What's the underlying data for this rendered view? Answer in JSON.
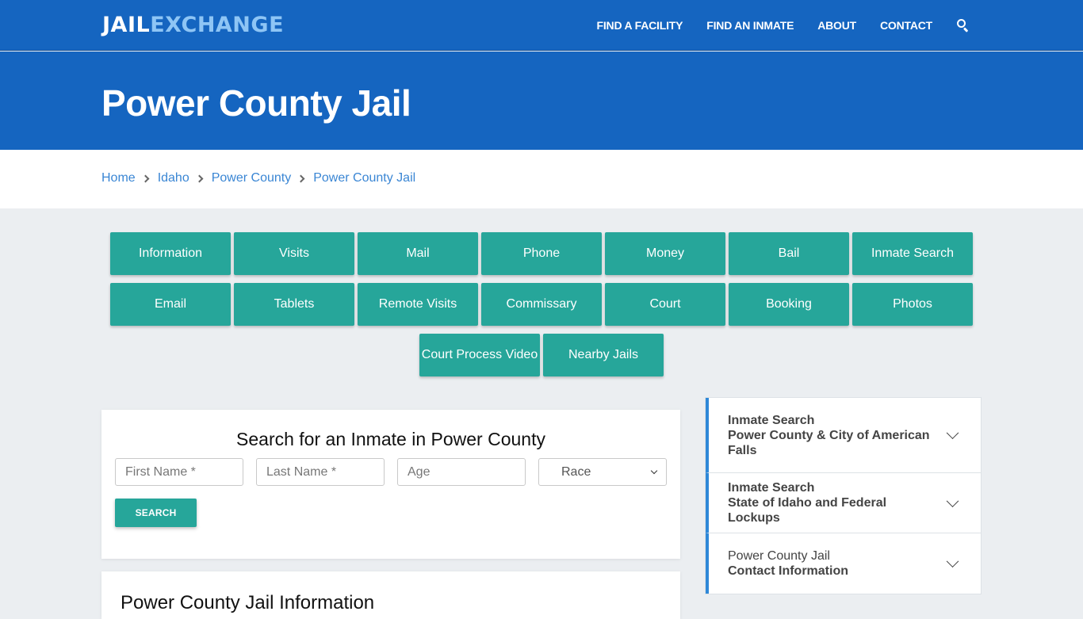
{
  "header": {
    "logo_part1": "JAIL",
    "logo_part2": "EXCHANGE",
    "nav": [
      {
        "label": "FIND A FACILITY"
      },
      {
        "label": "FIND AN INMATE"
      },
      {
        "label": "ABOUT"
      },
      {
        "label": "CONTACT"
      }
    ],
    "search_icon": "search-icon"
  },
  "hero": {
    "title": "Power County Jail"
  },
  "breadcrumb": [
    {
      "label": "Home"
    },
    {
      "label": "Idaho"
    },
    {
      "label": "Power County"
    },
    {
      "label": "Power County Jail"
    }
  ],
  "tiles": [
    {
      "label": "Information"
    },
    {
      "label": "Visits"
    },
    {
      "label": "Mail"
    },
    {
      "label": "Phone"
    },
    {
      "label": "Money"
    },
    {
      "label": "Bail"
    },
    {
      "label": "Inmate Search"
    },
    {
      "label": "Email"
    },
    {
      "label": "Tablets"
    },
    {
      "label": "Remote Visits"
    },
    {
      "label": "Commissary"
    },
    {
      "label": "Court"
    },
    {
      "label": "Booking"
    },
    {
      "label": "Photos"
    },
    {
      "label": "Court Process Video"
    },
    {
      "label": "Nearby Jails"
    }
  ],
  "search": {
    "title": "Search for an Inmate in Power County",
    "first_name_placeholder": "First Name *",
    "last_name_placeholder": "Last Name *",
    "age_placeholder": "Age",
    "race_selected": "Race",
    "button": "SEARCH"
  },
  "info": {
    "title": "Power County Jail Information"
  },
  "sidebar": [
    {
      "line1": "Inmate Search",
      "line2": "Power County & City of American Falls"
    },
    {
      "line1": "Inmate Search",
      "line2": "State of Idaho and Federal Lockups"
    },
    {
      "line1": "Power County Jail",
      "line2": "Contact Information"
    }
  ],
  "colors": {
    "primary_blue": "#1565c0",
    "teal": "#26a69a",
    "link_blue": "#3a86d4",
    "accent_border": "#2f88d8"
  }
}
